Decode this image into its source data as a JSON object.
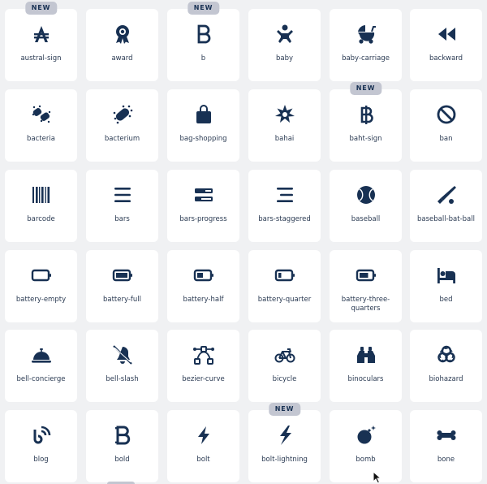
{
  "badge_text": "NEW",
  "colors": {
    "icon": "#183153",
    "tile": "#ffffff",
    "background": "#f0f1f3",
    "badge": "#c3c6d1"
  },
  "icons": [
    {
      "label": "austral-sign",
      "icon": "austral-sign-icon",
      "is_new": true
    },
    {
      "label": "award",
      "icon": "award-icon",
      "is_new": false
    },
    {
      "label": "b",
      "icon": "b-icon",
      "is_new": true
    },
    {
      "label": "baby",
      "icon": "baby-icon",
      "is_new": false
    },
    {
      "label": "baby-carriage",
      "icon": "baby-carriage-icon",
      "is_new": false
    },
    {
      "label": "backward",
      "icon": "backward-icon",
      "is_new": false
    },
    {
      "label": "bacteria",
      "icon": "bacteria-icon",
      "is_new": false
    },
    {
      "label": "bacterium",
      "icon": "bacterium-icon",
      "is_new": false
    },
    {
      "label": "bag-shopping",
      "icon": "bag-shopping-icon",
      "is_new": false
    },
    {
      "label": "bahai",
      "icon": "bahai-icon",
      "is_new": false
    },
    {
      "label": "baht-sign",
      "icon": "baht-sign-icon",
      "is_new": true
    },
    {
      "label": "ban",
      "icon": "ban-icon",
      "is_new": false
    },
    {
      "label": "barcode",
      "icon": "barcode-icon",
      "is_new": false
    },
    {
      "label": "bars",
      "icon": "bars-icon",
      "is_new": false
    },
    {
      "label": "bars-progress",
      "icon": "bars-progress-icon",
      "is_new": false
    },
    {
      "label": "bars-staggered",
      "icon": "bars-staggered-icon",
      "is_new": false
    },
    {
      "label": "baseball",
      "icon": "baseball-icon",
      "is_new": false
    },
    {
      "label": "baseball-bat-ball",
      "icon": "baseball-bat-ball-icon",
      "is_new": false
    },
    {
      "label": "battery-empty",
      "icon": "battery-empty-icon",
      "is_new": false
    },
    {
      "label": "battery-full",
      "icon": "battery-full-icon",
      "is_new": false
    },
    {
      "label": "battery-half",
      "icon": "battery-half-icon",
      "is_new": false
    },
    {
      "label": "battery-quarter",
      "icon": "battery-quarter-icon",
      "is_new": false
    },
    {
      "label": "battery-three-quarters",
      "icon": "battery-three-quarters-icon",
      "is_new": false
    },
    {
      "label": "bed",
      "icon": "bed-icon",
      "is_new": false
    },
    {
      "label": "bell-concierge",
      "icon": "bell-concierge-icon",
      "is_new": false
    },
    {
      "label": "bell-slash",
      "icon": "bell-slash-icon",
      "is_new": false
    },
    {
      "label": "bezier-curve",
      "icon": "bezier-curve-icon",
      "is_new": false
    },
    {
      "label": "bicycle",
      "icon": "bicycle-icon",
      "is_new": false
    },
    {
      "label": "binoculars",
      "icon": "binoculars-icon",
      "is_new": false
    },
    {
      "label": "biohazard",
      "icon": "biohazard-icon",
      "is_new": false
    },
    {
      "label": "blog",
      "icon": "blog-icon",
      "is_new": false
    },
    {
      "label": "bold",
      "icon": "bold-icon",
      "is_new": false
    },
    {
      "label": "bolt",
      "icon": "bolt-icon",
      "is_new": false
    },
    {
      "label": "bolt-lightning",
      "icon": "bolt-lightning-icon",
      "is_new": true
    },
    {
      "label": "bomb",
      "icon": "bomb-icon",
      "is_new": false
    },
    {
      "label": "bone",
      "icon": "bone-icon",
      "is_new": false
    }
  ]
}
